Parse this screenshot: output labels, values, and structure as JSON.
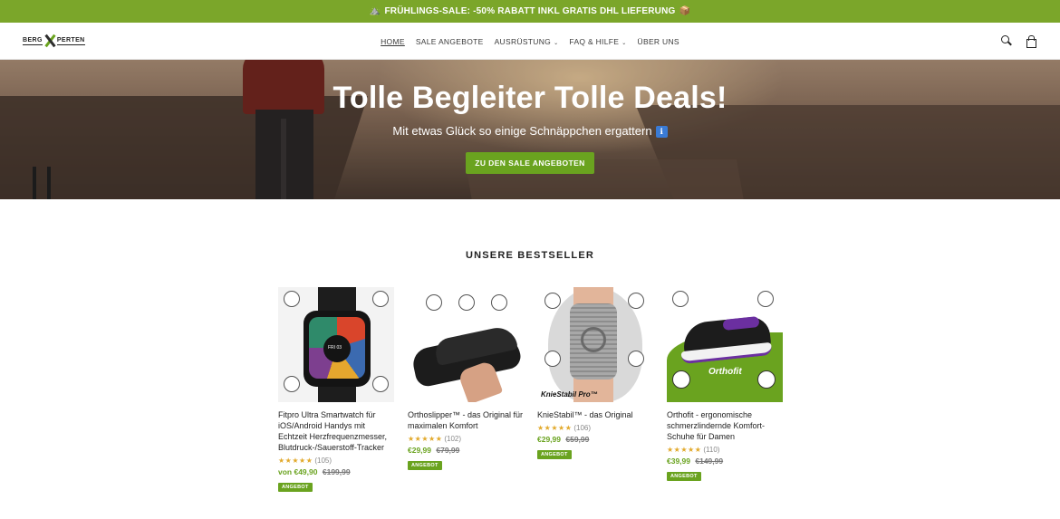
{
  "announcement": {
    "left_emoji": "⛰️",
    "text": "FRÜHLINGS-SALE: -50% RABATT INKL GRATIS DHL LIEFERUNG",
    "right_emoji": "📦"
  },
  "header": {
    "logo_left": "BERG",
    "logo_right": "PERTEN",
    "nav": [
      {
        "label": "HOME",
        "active": true,
        "dropdown": false
      },
      {
        "label": "SALE ANGEBOTE",
        "active": false,
        "dropdown": false
      },
      {
        "label": "AUSRÜSTUNG",
        "active": false,
        "dropdown": true
      },
      {
        "label": "FAQ & HILFE",
        "active": false,
        "dropdown": true
      },
      {
        "label": "ÜBER UNS",
        "active": false,
        "dropdown": false
      }
    ],
    "icons": [
      "search-icon",
      "cart-icon"
    ]
  },
  "hero": {
    "title": "Tolle Begleiter Tolle Deals!",
    "subtitle": "Mit etwas Glück so einige Schnäppchen ergattern",
    "info_icon": "ℹ",
    "button": "ZU DEN SALE ANGEBOTEN"
  },
  "bestsellers": {
    "title": "UNSERE BESTSELLER",
    "products": [
      {
        "name": "Fitpro Ultra Smartwatch für iOS/Android Handys mit Echtzeit Herzfrequenzmesser, Blutdruck-/Sauerstoff-Tracker",
        "stars": "★★★★★",
        "reviews": "(105)",
        "price": "von €49,90",
        "old_price": "€199,99",
        "badge": "ANGEBOT",
        "image_text": "FRI 03"
      },
      {
        "name": "Orthoslipper™ - das Original für maximalen Komfort",
        "stars": "★★★★★",
        "reviews": "(102)",
        "price": "€29,99",
        "old_price": "€79,99",
        "badge": "ANGEBOT",
        "image_text": ""
      },
      {
        "name": "KnieStabil™ - das Original",
        "stars": "★★★★★",
        "reviews": "(106)",
        "price": "€29,99",
        "old_price": "€59,99",
        "badge": "ANGEBOT",
        "image_text": "KnieStabil Pro™"
      },
      {
        "name": "Orthofit - ergonomische schmerzlindernde Komfort-Schuhe für Damen",
        "stars": "★★★★★",
        "reviews": "(110)",
        "price": "€39,99",
        "old_price": "€149,99",
        "badge": "ANGEBOT",
        "image_text": "Orthofit"
      }
    ]
  },
  "colors": {
    "brand_green": "#6aa31f",
    "announcement_bg": "#7ba62a",
    "star": "#e2a92b"
  }
}
